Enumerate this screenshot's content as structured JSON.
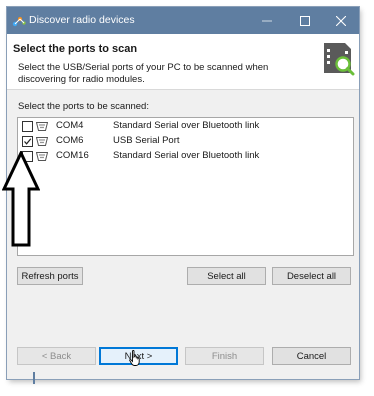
{
  "window": {
    "title": "Discover radio devices",
    "accent": "#5f7ea1"
  },
  "header": {
    "title": "Select the ports to scan",
    "description": "Select the USB/Serial ports of your PC to be scanned when discovering for radio modules.",
    "icon": "device-search-icon"
  },
  "ports": {
    "label": "Select the ports to be scanned:",
    "items": [
      {
        "name": "COM4",
        "description": "Standard Serial over Bluetooth link",
        "checked": false
      },
      {
        "name": "COM6",
        "description": "USB Serial Port",
        "checked": true
      },
      {
        "name": "COM16",
        "description": "Standard Serial over Bluetooth link",
        "checked": false
      }
    ]
  },
  "actions": {
    "refresh": "Refresh ports",
    "select_all": "Select all",
    "deselect_all": "Deselect all"
  },
  "nav": {
    "back": "< Back",
    "next": "Next >",
    "finish": "Finish",
    "cancel": "Cancel"
  }
}
